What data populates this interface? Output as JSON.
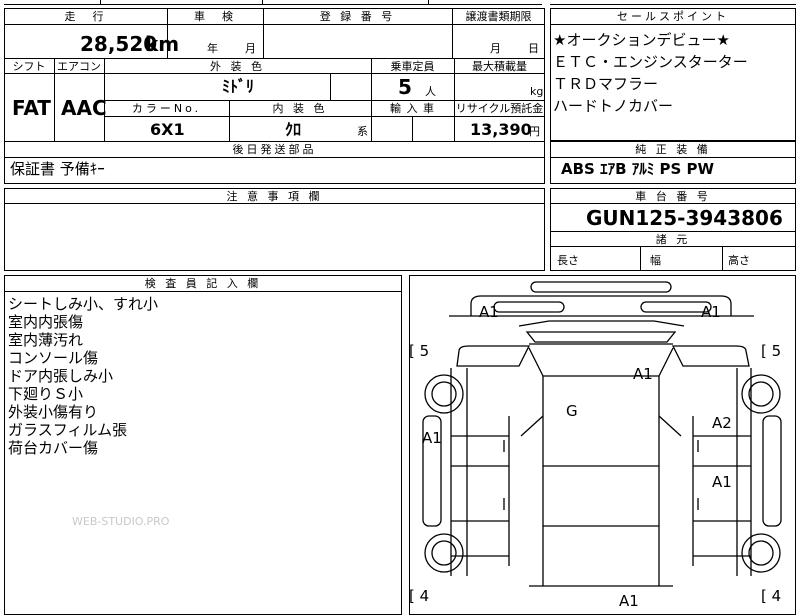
{
  "headers": {
    "mileage": "走　行",
    "inspection": "車　検",
    "reg_no": "登 録 番 号",
    "transfer": "譲渡書類期限",
    "sales_point": "セールスポイント",
    "shift": "シフト",
    "aircon": "エアコン",
    "ext_color": "外 装 色",
    "capacity": "乗車定員",
    "max_load": "最大積載量",
    "color_no": "カラーNo.",
    "int_color": "内 装 色",
    "import": "輸 入 車",
    "recycle": "リサイクル預託金",
    "post_parts": "後日発送部品",
    "genuine": "純 正 装 備",
    "caution": "注 意 事 項 欄",
    "chassis": "車 台 番 号",
    "dims": "諸 元",
    "inspector": "検 査 員 記 入 欄"
  },
  "values": {
    "mileage": "28,520",
    "mileage_unit": "km",
    "year_unit": "年",
    "month_unit": "月",
    "transfer_month": "月",
    "transfer_day": "日",
    "shift": "FAT",
    "aircon": "AAC",
    "ext_color": "ﾐﾄﾞﾘ",
    "capacity": "5",
    "capacity_unit": "人",
    "load_unit": "kg",
    "color_no": "6X1",
    "int_color": "ｸﾛ",
    "int_suffix": "系",
    "recycle": "13,390",
    "recycle_unit": "円",
    "post_parts": "保証書 予備ｷｰ",
    "genuine": "ABS ｴｱB ｱﾙﾐ PS PW",
    "chassis": "GUN125-3943806",
    "len": "長さ",
    "width": "幅",
    "height": "高さ"
  },
  "sales_points": [
    "★オークションデビュー★",
    "ＥＴＣ・エンジンスターター",
    "ＴＲＤマフラー",
    "ハードトノカバー"
  ],
  "inspector_notes": [
    "シートしみ小、すれ小",
    "室内内張傷",
    "室内薄汚れ",
    "コンソール傷",
    "ドア内張しみ小",
    "下廻りＳ小",
    "外装小傷有り",
    "ガラスフィルム張",
    "荷台カバー傷"
  ],
  "watermark": "WEB-STUDIO.PRO",
  "diagram": {
    "marks": [
      "A1",
      "A1",
      "A1",
      "G",
      "A1",
      "A2",
      "A1",
      "A1"
    ],
    "tire_left_front": "[ 5",
    "tire_right_front": "[ 5",
    "tire_left_rear": "[ 4",
    "tire_right_rear": "[ 4"
  }
}
